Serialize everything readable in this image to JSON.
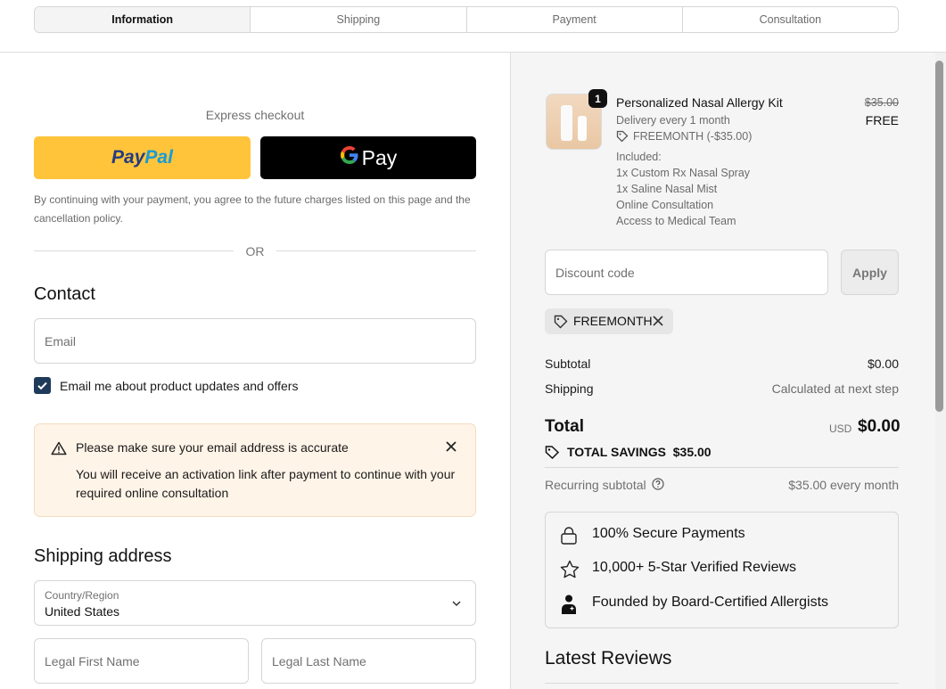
{
  "steps": [
    "Information",
    "Shipping",
    "Payment",
    "Consultation"
  ],
  "express": {
    "title": "Express checkout",
    "paypal_a": "Pay",
    "paypal_b": "Pal",
    "gpay_g": "G",
    "gpay_text": "Pay",
    "disclaimer": "By continuing with your payment, you agree to the future charges listed on this page and the cancellation policy."
  },
  "or_text": "OR",
  "contact": {
    "heading": "Contact",
    "email_placeholder": "Email",
    "checkbox_label": "Email me about product updates and offers"
  },
  "alert": {
    "title": "Please make sure your email address is accurate",
    "body": "You will receive an activation link after payment to continue with your required online consultation"
  },
  "shipping": {
    "heading": "Shipping address",
    "country_label": "Country/Region",
    "country_value": "United States",
    "first_name_placeholder": "Legal First Name",
    "last_name_placeholder": "Legal Last Name"
  },
  "product": {
    "quantity": "1",
    "name": "Personalized Nasal Allergy Kit",
    "delivery": "Delivery every 1 month",
    "discount": "FREEMONTH (-$35.00)",
    "included_title": "Included:",
    "included": [
      "1x Custom Rx Nasal Spray",
      "1x Saline Nasal Mist",
      "Online Consultation",
      "Access to Medical Team"
    ],
    "price_old": "$35.00",
    "price_new": "FREE"
  },
  "discount": {
    "placeholder": "Discount code",
    "apply_label": "Apply",
    "applied_code": "FREEMONTH"
  },
  "summary": {
    "subtotal_label": "Subtotal",
    "subtotal_value": "$0.00",
    "shipping_label": "Shipping",
    "shipping_value": "Calculated at next step",
    "total_label": "Total",
    "total_currency": "USD",
    "total_value": "$0.00",
    "savings": "TOTAL SAVINGS  $35.00",
    "recurring_label": "Recurring subtotal",
    "recurring_value": "$35.00 every month"
  },
  "trust": [
    "100% Secure Payments",
    "10,000+ 5-Star Verified Reviews",
    "Founded by Board-Certified Allergists"
  ],
  "reviews_title": "Latest Reviews",
  "icons": [
    "tag-icon",
    "warning-icon",
    "close-icon",
    "chevron-down-icon",
    "lock-icon",
    "star-icon",
    "doctor-icon",
    "help-icon",
    "check-icon"
  ],
  "colors": {
    "paypal_yellow": "#ffc439",
    "alert_bg": "#fff4e8",
    "checkbox": "#1f3a5a"
  }
}
